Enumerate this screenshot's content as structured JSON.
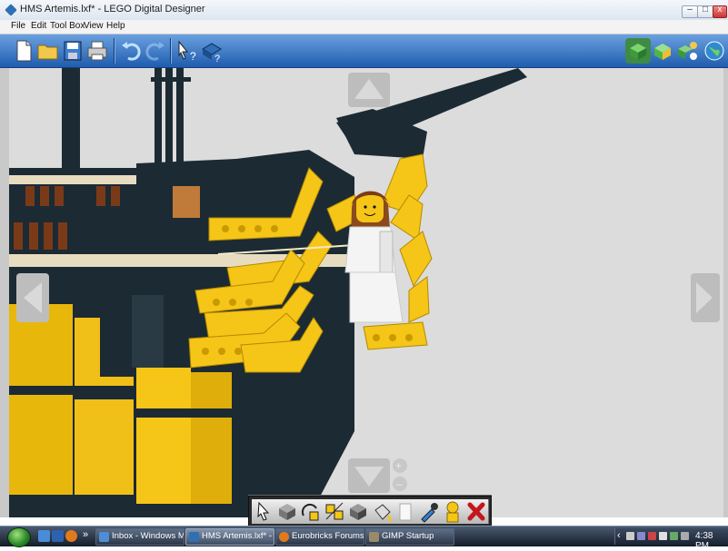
{
  "window": {
    "title": "HMS Artemis.lxf* - LEGO Digital Designer",
    "controls": {
      "minimize": "–",
      "maximize": "□",
      "close": "x"
    }
  },
  "menu": [
    "File",
    "Edit",
    "Tool Box",
    "View",
    "Help"
  ],
  "toolbar": {
    "left_icons": [
      "new-file-icon",
      "open-folder-icon",
      "save-disk-icon",
      "print-icon",
      "undo-icon",
      "redo-icon",
      "help-pointer-icon",
      "help-brick-icon"
    ],
    "right_icons": [
      "build-mode-icon",
      "view-mode-icon",
      "building-guide-icon",
      "globe-icon"
    ]
  },
  "palette": {
    "tools": [
      "select-arrow-icon",
      "clone-icon",
      "hinge-icon",
      "hinge-align-icon",
      "flex-icon",
      "paint-bucket-icon",
      "hide-icon",
      "color-picker-icon",
      "minifig-icon",
      "delete-icon"
    ]
  },
  "taskbar": {
    "tasks": [
      {
        "label": "Inbox - Windows Mail",
        "icon_color": "#4c8fd6"
      },
      {
        "label": "HMS Artemis.lxf* - L...",
        "icon_color": "#2f6fb3",
        "active": true
      },
      {
        "label": "Eurobricks Forums -...",
        "icon_color": "#e07a1f"
      },
      {
        "label": "GIMP Startup",
        "icon_color": "#9a8a6a"
      }
    ],
    "chevron": "»",
    "clock": "4:38 PM",
    "tray_left_arrow": "‹"
  },
  "colors": {
    "navy": "#1c2a33",
    "yellow": "#f5c518",
    "white_fig": "#f4f4f4",
    "background": "#dcdcdc",
    "toolbar_blue": "#2a66b6"
  }
}
